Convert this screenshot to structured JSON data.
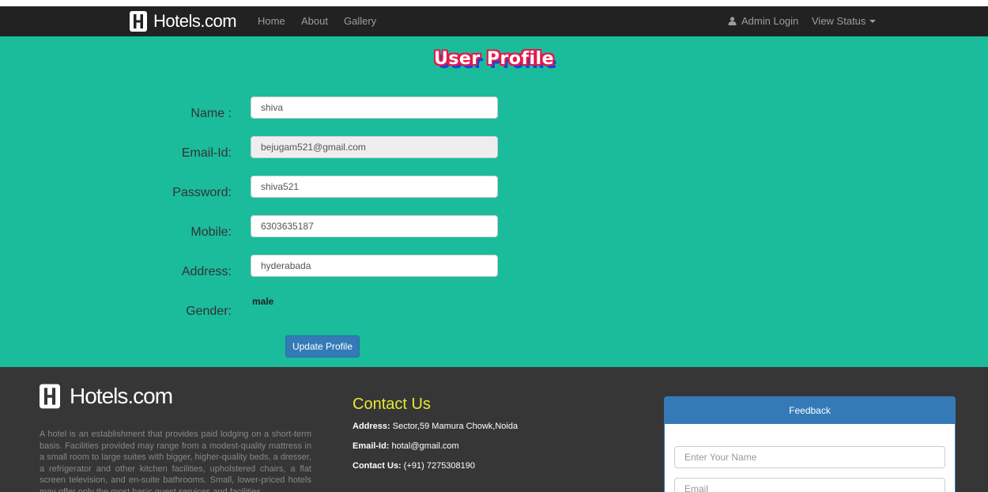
{
  "nav": {
    "brand": "Hotels.com",
    "links": [
      "Home",
      "About",
      "Gallery"
    ],
    "admin_login": "Admin Login",
    "view_status": "View Status"
  },
  "profile": {
    "title": "User Profile",
    "name_label": "Name :",
    "name_value": "shiva",
    "email_label": "Email-Id:",
    "email_value": "bejugam521@gmail.com",
    "password_label": "Password:",
    "password_value": "shiva521",
    "mobile_label": "Mobile:",
    "mobile_value": "6303635187",
    "address_label": "Address:",
    "address_value": "hyderabada",
    "gender_label": "Gender:",
    "gender_value": "male",
    "update_button": "Update Profile"
  },
  "footer": {
    "brand": "Hotels.com",
    "about": "A hotel is an establishment that provides paid lodging on a short-term basis. Facilities provided may range from a modest-quality mattress in a small room to large suites with bigger, higher-quality beds, a dresser, a refrigerator and other kitchen facilities, upholstered chairs, a flat screen television, and en-suite bathrooms. Small, lower-priced hotels may offer only the most basic guest services and facilities.",
    "contact_heading": "Contact Us",
    "address_label": "Address:",
    "address_value": "Sector,59 Mamura Chowk,Noida",
    "email_label": "Email-Id:",
    "email_value": "hotal@gmail.com",
    "contact_label": "Contact Us:",
    "contact_value": "(+91) 7275308190",
    "feedback": {
      "title": "Feedback",
      "name_placeholder": "Enter Your Name",
      "email_placeholder": "Email"
    }
  },
  "colors": {
    "navbar_bg": "#222222",
    "teal": "#1abc9c",
    "footer_bg": "#363636",
    "primary": "#337ab7",
    "contact_heading": "#e8e832"
  },
  "icons": [
    "hotels-logo-icon",
    "user-icon",
    "caret-down-icon"
  ]
}
